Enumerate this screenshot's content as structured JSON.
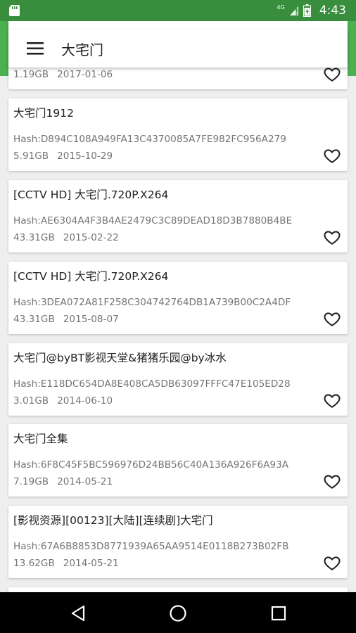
{
  "status_bar": {
    "network": "4G",
    "time": "4:43"
  },
  "toolbar": {
    "title": "大宅门"
  },
  "partial_top": {
    "size": "1.19GB",
    "date": "2017-01-06"
  },
  "items": [
    {
      "name": "大宅门1912",
      "hash": "Hash:D894C108A949FA13C4370085A7FE982FC956A279",
      "size": "5.91GB",
      "date": "2015-10-29"
    },
    {
      "name": "[CCTV HD] 大宅门.720P.X264",
      "hash": "Hash:AE6304A4F3B4AE2479C3C89DEAD18D3B7880B4BE",
      "size": "43.31GB",
      "date": "2015-02-22"
    },
    {
      "name": "[CCTV HD] 大宅门.720P.X264",
      "hash": "Hash:3DEA072A81F258C304742764DB1A739B00C2A4DF",
      "size": "43.31GB",
      "date": "2015-08-07"
    },
    {
      "name": "大宅门@byBT影视天堂&猪猪乐园@by冰水",
      "hash": "Hash:E118DC654DA8E408CA5DB63097FFFC47E105ED28",
      "size": "3.01GB",
      "date": "2014-06-10"
    },
    {
      "name": "大宅门全集",
      "hash": "Hash:6F8C45F5BC596976D24BB56C40A136A926F6A93A",
      "size": "7.19GB",
      "date": "2014-05-21"
    },
    {
      "name": "[影视资源][00123][大陆][连续剧]大宅门",
      "hash": "Hash:67A6B8853D8771939A65AA9514E0118B273B02FB",
      "size": "13.62GB",
      "date": "2014-05-21"
    }
  ],
  "colors": {
    "primary": "#4caf50",
    "primary_dark": "#388e3c",
    "background": "#eeeeee"
  }
}
